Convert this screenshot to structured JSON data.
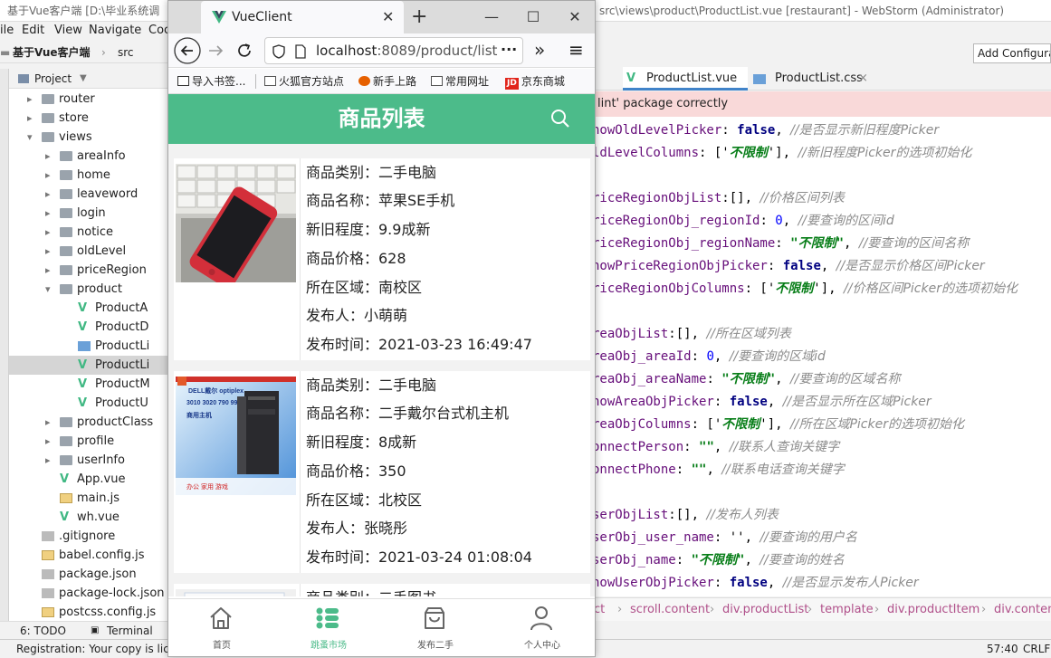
{
  "ide": {
    "title_left": "基于Vue客户端 [D:\\毕业系统调",
    "title_right": "src\\views\\product\\ProductList.vue [restaurant] - WebStorm (Administrator)",
    "menu": [
      "ile",
      "Edit",
      "View",
      "Navigate",
      "Coc"
    ],
    "crumb": [
      "基于Vue客户端",
      "src"
    ],
    "add_config": "Add Configura",
    "project_label": "Project",
    "tree": [
      {
        "label": "router",
        "type": "folder",
        "depth": 2,
        "arrow": "›"
      },
      {
        "label": "store",
        "type": "folder",
        "depth": 2,
        "arrow": "›"
      },
      {
        "label": "views",
        "type": "folder",
        "depth": 2,
        "arrow": "⌄"
      },
      {
        "label": "areaInfo",
        "type": "folder",
        "depth": 3,
        "arrow": "›"
      },
      {
        "label": "home",
        "type": "folder",
        "depth": 3,
        "arrow": "›"
      },
      {
        "label": "leaveword",
        "type": "folder",
        "depth": 3,
        "arrow": "›"
      },
      {
        "label": "login",
        "type": "folder",
        "depth": 3,
        "arrow": "›"
      },
      {
        "label": "notice",
        "type": "folder",
        "depth": 3,
        "arrow": "›"
      },
      {
        "label": "oldLevel",
        "type": "folder",
        "depth": 3,
        "arrow": "›"
      },
      {
        "label": "priceRegion",
        "type": "folder",
        "depth": 3,
        "arrow": "›"
      },
      {
        "label": "product",
        "type": "folder",
        "depth": 3,
        "arrow": "⌄"
      },
      {
        "label": "ProductA",
        "type": "vue",
        "depth": 4,
        "arrow": ""
      },
      {
        "label": "ProductD",
        "type": "vue",
        "depth": 4,
        "arrow": ""
      },
      {
        "label": "ProductLi",
        "type": "css",
        "depth": 4,
        "arrow": ""
      },
      {
        "label": "ProductLi",
        "type": "vue",
        "depth": 4,
        "arrow": "",
        "selected": true
      },
      {
        "label": "ProductM",
        "type": "vue",
        "depth": 4,
        "arrow": ""
      },
      {
        "label": "ProductU",
        "type": "vue",
        "depth": 4,
        "arrow": ""
      },
      {
        "label": "productClass",
        "type": "folder",
        "depth": 3,
        "arrow": "›"
      },
      {
        "label": "profile",
        "type": "folder",
        "depth": 3,
        "arrow": "›"
      },
      {
        "label": "userInfo",
        "type": "folder",
        "depth": 3,
        "arrow": "›"
      },
      {
        "label": "App.vue",
        "type": "vue",
        "depth": 3,
        "arrow": ""
      },
      {
        "label": "main.js",
        "type": "js",
        "depth": 3,
        "arrow": ""
      },
      {
        "label": "wh.vue",
        "type": "vue",
        "depth": 3,
        "arrow": ""
      },
      {
        "label": ".gitignore",
        "type": "file",
        "depth": 2,
        "arrow": ""
      },
      {
        "label": "babel.config.js",
        "type": "js",
        "depth": 2,
        "arrow": ""
      },
      {
        "label": "package.json",
        "type": "file",
        "depth": 2,
        "arrow": ""
      },
      {
        "label": "package-lock.json",
        "type": "file",
        "depth": 2,
        "arrow": ""
      },
      {
        "label": "postcss.config.js",
        "type": "js",
        "depth": 2,
        "arrow": ""
      }
    ],
    "bottom_tabs": {
      "todo": "6: TODO",
      "terminal": "Terminal"
    },
    "status_left": "Registration: Your copy is lic",
    "status_pos": "57:40",
    "status_crlf": "CRLF",
    "editor_tabs": [
      "ProductList.vue",
      "ProductList.css"
    ],
    "warning": "lint' package correctly",
    "code_lines": [
      [
        [
          "k2",
          "howOldLevelPicker"
        ],
        [
          "p",
          ": "
        ],
        [
          "k",
          "false"
        ],
        [
          "p",
          ", "
        ],
        [
          "c",
          "//是否显示新旧程度Picker"
        ]
      ],
      [
        [
          "k2",
          "ldLevelColumns"
        ],
        [
          "p",
          ": ['"
        ],
        [
          "s",
          "不限制"
        ],
        [
          "p",
          "'], "
        ],
        [
          "c",
          "//新旧程度Picker的选项初始化"
        ]
      ],
      [],
      [
        [
          "k2",
          "riceRegionObjList"
        ],
        [
          "p",
          ":[], "
        ],
        [
          "c",
          "//价格区间列表"
        ]
      ],
      [
        [
          "k2",
          "riceRegionObj_regionId"
        ],
        [
          "p",
          ": "
        ],
        [
          "n",
          "0"
        ],
        [
          "p",
          ",  "
        ],
        [
          "c",
          "//要查询的区间id"
        ]
      ],
      [
        [
          "k2",
          "riceRegionObj_regionName"
        ],
        [
          "p",
          ": "
        ],
        [
          "s",
          "\"不限制\""
        ],
        [
          "p",
          ", "
        ],
        [
          "c",
          "//要查询的区间名称"
        ]
      ],
      [
        [
          "k2",
          "howPriceRegionObjPicker"
        ],
        [
          "p",
          ": "
        ],
        [
          "k",
          "false"
        ],
        [
          "p",
          ", "
        ],
        [
          "c",
          "//是否显示价格区间Picker"
        ]
      ],
      [
        [
          "k2",
          "riceRegionObjColumns"
        ],
        [
          "p",
          ": ['"
        ],
        [
          "s",
          "不限制"
        ],
        [
          "p",
          "'], "
        ],
        [
          "c",
          "//价格区间Picker的选项初始化"
        ]
      ],
      [],
      [
        [
          "k2",
          "reaObjList"
        ],
        [
          "p",
          ":[], "
        ],
        [
          "c",
          "//所在区域列表"
        ]
      ],
      [
        [
          "k2",
          "reaObj_areaId"
        ],
        [
          "p",
          ": "
        ],
        [
          "n",
          "0"
        ],
        [
          "p",
          ",  "
        ],
        [
          "c",
          "//要查询的区域id"
        ]
      ],
      [
        [
          "k2",
          "reaObj_areaName"
        ],
        [
          "p",
          ": "
        ],
        [
          "s",
          "\"不限制\""
        ],
        [
          "p",
          ", "
        ],
        [
          "c",
          "//要查询的区域名称"
        ]
      ],
      [
        [
          "k2",
          "howAreaObjPicker"
        ],
        [
          "p",
          ": "
        ],
        [
          "k",
          "false"
        ],
        [
          "p",
          ", "
        ],
        [
          "c",
          "//是否显示所在区域Picker"
        ]
      ],
      [
        [
          "k2",
          "reaObjColumns"
        ],
        [
          "p",
          ": ['"
        ],
        [
          "s",
          "不限制"
        ],
        [
          "p",
          "'], "
        ],
        [
          "c",
          "//所在区域Picker的选项初始化"
        ]
      ],
      [
        [
          "k2",
          "onnectPerson"
        ],
        [
          "p",
          ": "
        ],
        [
          "s",
          "\"\""
        ],
        [
          "p",
          ", "
        ],
        [
          "c",
          "//联系人查询关键字"
        ]
      ],
      [
        [
          "k2",
          "onnectPhone"
        ],
        [
          "p",
          ": "
        ],
        [
          "s",
          "\"\""
        ],
        [
          "p",
          ", "
        ],
        [
          "c",
          "//联系电话查询关键字"
        ]
      ],
      [],
      [
        [
          "k2",
          "serObjList"
        ],
        [
          "p",
          ":[], "
        ],
        [
          "c",
          "//发布人列表"
        ]
      ],
      [
        [
          "k2",
          "serObj_user_name"
        ],
        [
          "p",
          ": '', "
        ],
        [
          "c",
          "//要查询的用户名"
        ]
      ],
      [
        [
          "k2",
          "serObj_name"
        ],
        [
          "p",
          ": "
        ],
        [
          "s",
          "\"不限制\""
        ],
        [
          "p",
          ", "
        ],
        [
          "c",
          "//要查询的姓名"
        ]
      ],
      [
        [
          "k2",
          "howUserObjPicker"
        ],
        [
          "p",
          ": "
        ],
        [
          "k",
          "false"
        ],
        [
          "p",
          ", "
        ],
        [
          "c",
          "//是否显示发布人Picker"
        ]
      ]
    ],
    "editor_crumb": [
      "ct",
      "scroll.content",
      "div.productList",
      "template",
      "div.productItem",
      "div.content"
    ]
  },
  "browser": {
    "tab_title": "VueClient",
    "url_host": "localhost",
    "url_rest": ":8089/product/list",
    "bookmarks": [
      "导入书签...",
      "火狐官方站点",
      "新手上路",
      "常用网址",
      "京东商城"
    ],
    "jd_badge": "JD"
  },
  "app": {
    "title": "商品列表",
    "colors": {
      "primary": "#4cbb8a"
    },
    "products": [
      {
        "category": "商品类别：二手电脑",
        "name": "商品名称：苹果SE手机",
        "condition": "新旧程度：9.9成新",
        "price": "商品价格：628",
        "area": "所在区域：南校区",
        "publisher": "发布人：小萌萌",
        "time": "发布时间：2021-03-23 16:49:47"
      },
      {
        "category": "商品类别：二手电脑",
        "name": "商品名称：二手戴尔台式机主机",
        "condition": "新旧程度：8成新",
        "price": "商品价格：350",
        "area": "所在区域：北校区",
        "publisher": "发布人：张晓彤",
        "time": "发布时间：2021-03-24 01:08:04"
      },
      {
        "category": "商品类别：二手图书"
      }
    ],
    "dell_img_text": {
      "line1": "DELL戴尔 optiplex",
      "line2": "3010 3020 790 990",
      "line3": "商用主机",
      "line4": "办公  家用  游戏"
    },
    "tabs": [
      {
        "label": "首页",
        "icon": "home-icon",
        "active": false
      },
      {
        "label": "跳蚤市场",
        "icon": "list-icon",
        "active": true
      },
      {
        "label": "发布二手",
        "icon": "bag-icon",
        "active": false
      },
      {
        "label": "个人中心",
        "icon": "user-icon",
        "active": false
      }
    ]
  }
}
